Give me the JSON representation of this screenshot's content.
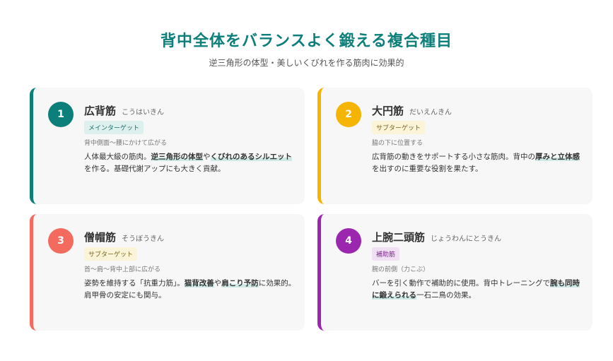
{
  "header": {
    "title": "背中全体をバランスよく鍛える複合種目",
    "subtitle": "逆三角形の体型・美しいくびれを作る筋肉に効果的"
  },
  "colors": {
    "teal": "#0d7f7a",
    "amber": "#f5b400",
    "coral": "#f26b5e",
    "purple": "#9b27af"
  },
  "cards": [
    {
      "number": "1",
      "name": "広背筋",
      "reading": "こうはいきん",
      "badge": "メインターゲット",
      "location": "背中側面〜腰にかけて広がる",
      "desc": [
        "人体最大級の筋肉。",
        "逆三角形の体型",
        "や",
        "くびれのあるシルエット",
        "を作る。基礎代謝アップにも大きく貢献。"
      ]
    },
    {
      "number": "2",
      "name": "大円筋",
      "reading": "だいえんきん",
      "badge": "サブターゲット",
      "location": "脇の下に位置する",
      "desc": [
        "広背筋の動きをサポートする小さな筋肉。背中の",
        "厚みと立体感",
        "を出すのに重要な役割を果たす。"
      ]
    },
    {
      "number": "3",
      "name": "僧帽筋",
      "reading": "そうぼうきん",
      "badge": "サブターゲット",
      "location": "首〜肩〜背中上部に広がる",
      "desc": [
        "姿勢を維持する「抗重力筋」。",
        "猫背改善",
        "や",
        "肩こり予防",
        "に効果的。肩甲骨の安定にも関与。"
      ]
    },
    {
      "number": "4",
      "name": "上腕二頭筋",
      "reading": "じょうわんにとうきん",
      "badge": "補助筋",
      "location": "腕の前側（力こぶ）",
      "desc": [
        "バーを引く動作で補助的に使用。背中トレーニングで",
        "腕も同時に鍛えられる",
        "一石二鳥の効果。"
      ]
    }
  ]
}
